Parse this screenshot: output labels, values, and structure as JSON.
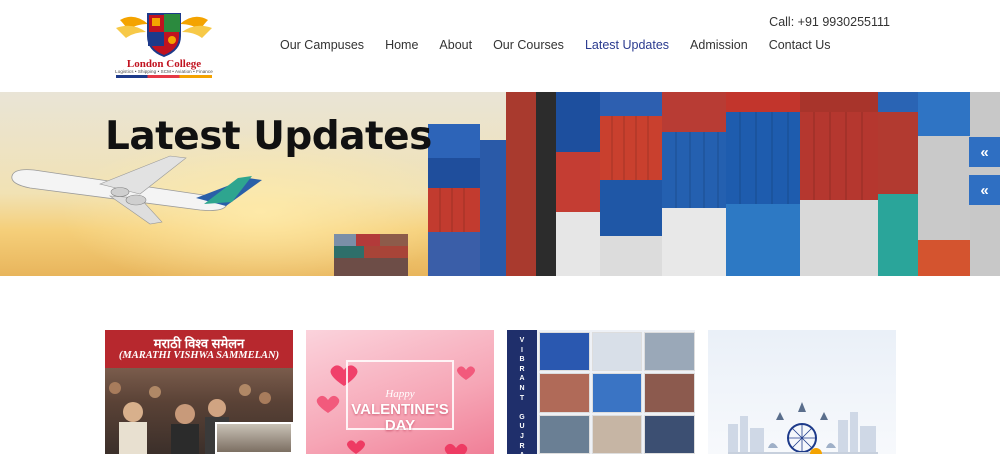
{
  "brand": {
    "name": "London College",
    "tagline": "Logistics • Shipping • SCM • Aviation • Finance"
  },
  "contact": {
    "call_label": "Call: +91 9930255111"
  },
  "nav": {
    "items": [
      {
        "label": "Our Campuses",
        "active": false
      },
      {
        "label": "Home",
        "active": false
      },
      {
        "label": "About",
        "active": false
      },
      {
        "label": "Our Courses",
        "active": false
      },
      {
        "label": "Latest Updates",
        "active": true
      },
      {
        "label": "Admission",
        "active": false
      },
      {
        "label": "Contact Us",
        "active": false
      }
    ]
  },
  "banner": {
    "title": "Latest Updates"
  },
  "side_tabs": {
    "icon": "double-chevron-left-icon",
    "glyph": "«"
  },
  "cards": [
    {
      "title": "मराठी विश्व समेलन",
      "subtitle": "(MARATHI VISHWA SAMMELAN)"
    },
    {
      "happy": "Happy",
      "title_line1": "VALENTINE'S",
      "title_line2": "DAY"
    },
    {
      "vertical_text": "VIBRANT GUJRA"
    },
    {
      "theme": "india-skyline-with-ashoka-chakra"
    }
  ],
  "colors": {
    "nav_active": "#2a3a8f",
    "side_tab": "#2f6fc2",
    "card1_bg": "#b7282e"
  }
}
